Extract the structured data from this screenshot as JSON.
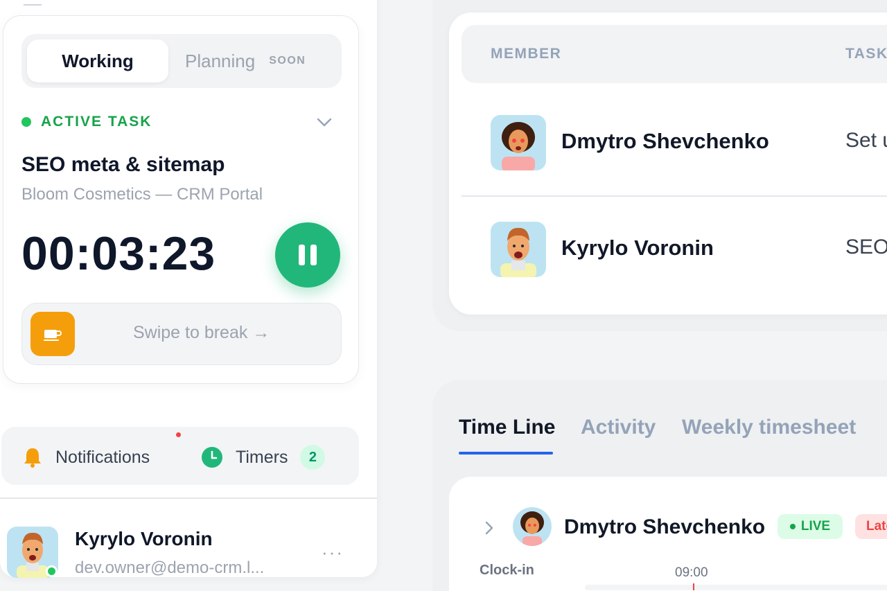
{
  "sidebar": {
    "modes": {
      "working": "Working",
      "planning": "Planning",
      "soon": "SOON"
    },
    "active_task": {
      "status_label": "ACTIVE TASK",
      "title": "SEO meta & sitemap",
      "project": "Bloom Cosmetics — CRM Portal",
      "elapsed": "00:03:23"
    },
    "swipe_label": "Swipe to break →",
    "notifications_label": "Notifications",
    "timers_label": "Timers",
    "timers_count": "2",
    "user": {
      "name": "Kyrylo Voronin",
      "email": "dev.owner@demo-crm.l...",
      "more": "···"
    }
  },
  "members": {
    "columns": {
      "member": "MEMBER",
      "task": "TASK"
    },
    "rows": [
      {
        "name": "Dmytro Shevchenko",
        "task": "Set u"
      },
      {
        "name": "Kyrylo Voronin",
        "task": "SEO"
      }
    ]
  },
  "timeline": {
    "tabs": [
      "Time Line",
      "Activity",
      "Weekly timesheet"
    ],
    "row": {
      "name": "Dmytro Shevchenko",
      "live_label": "LIVE",
      "late_label": "Late"
    },
    "clockin_label": "Clock-in",
    "hour_label": "09:00"
  },
  "colors": {
    "accent_green": "#22b77a",
    "active_green": "#16a34a",
    "tab_underline": "#2563eb",
    "break_orange": "#f59e0b"
  },
  "icons": [
    "chevron-down-icon",
    "pause-icon",
    "coffee-icon",
    "bell-icon",
    "clock-icon",
    "more-icon",
    "chevron-right-icon"
  ]
}
